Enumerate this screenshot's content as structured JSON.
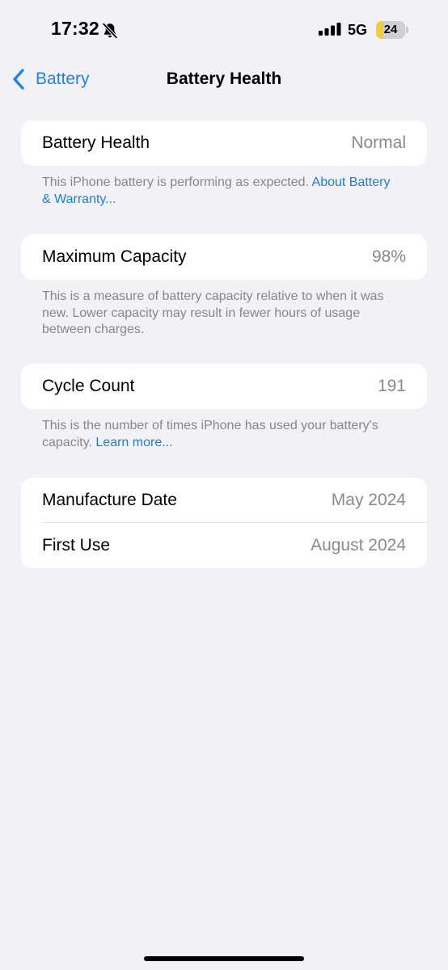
{
  "status_bar": {
    "time": "17:32",
    "network": "5G",
    "battery_level": "24",
    "battery_percent": 24,
    "silent_icon": "bell-slash-icon",
    "signal_icon": "cellular-signal-icon"
  },
  "nav": {
    "back_label": "Battery",
    "title": "Battery Health",
    "back_icon": "chevron-left-icon"
  },
  "sections": {
    "health": {
      "label": "Battery Health",
      "value": "Normal",
      "footnote": "This iPhone battery is performing as expected. ",
      "footnote_link": "About Battery & Warranty..."
    },
    "capacity": {
      "label": "Maximum Capacity",
      "value": "98%",
      "footnote": "This is a measure of battery capacity relative to when it was new. Lower capacity may result in fewer hours of usage between charges."
    },
    "cycle": {
      "label": "Cycle Count",
      "value": "191",
      "footnote": "This is the number of times iPhone has used your battery's capacity. ",
      "footnote_link": "Learn more..."
    },
    "dates": {
      "manufacture_label": "Manufacture Date",
      "manufacture_value": "May 2024",
      "first_use_label": "First Use",
      "first_use_value": "August 2024"
    }
  },
  "colors": {
    "background": "#f2f1f6",
    "accent": "#1c82f5",
    "secondary_text": "#8a8a8e",
    "battery_fill": "#f5cf2f"
  }
}
